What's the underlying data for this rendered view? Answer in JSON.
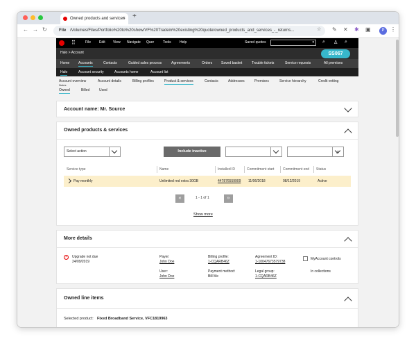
{
  "browser": {
    "tab_title": "Owned products and services",
    "tab_close": "×",
    "new_tab": "+",
    "url_scheme": "File",
    "url_path": "/Volumes/Files/Portfolio%20to%20show/VF%20Tradein%20existing%20quote/owned_products_and_services_-_returns...",
    "profile_initial": "P"
  },
  "top_menu": {
    "items": [
      "File",
      "Edit",
      "View",
      "Navigate",
      "Quer",
      "Tools",
      "Help"
    ],
    "saved_quotes": "Saved quotes"
  },
  "header": {
    "breadcrumb": "Halo  >  Account",
    "badge": "SS067"
  },
  "main_nav": {
    "items": [
      "Home",
      "Accounts",
      "Contacts",
      "Guided sales process",
      "Agreements",
      "Orders",
      "Saved basket",
      "Trouble tickets",
      "Service requests",
      "All premises"
    ],
    "active": "Accounts"
  },
  "sub_nav": {
    "items": [
      "Halo",
      "Account security",
      "Accounts home",
      "Account list"
    ],
    "active": "Halo"
  },
  "page_tabs": {
    "items": [
      "Account overview",
      "Account details",
      "Billing profiles",
      "Product & services",
      "Contacts",
      "Addresses",
      "Premises",
      "Service hierarchy",
      "Credit vetting"
    ],
    "notes": "Notes",
    "active": "Product & services"
  },
  "status_tabs": {
    "items": [
      "Owned",
      "Billed",
      "Used"
    ],
    "active": "Owned"
  },
  "account_panel": {
    "title": "Account name: Mr. Source"
  },
  "products_panel": {
    "title": "Owned products & services",
    "select_action": "Select action",
    "include_inactive": "Include inactive",
    "columns": [
      "Service type",
      "Name",
      "Installed ID",
      "Commitment start",
      "Commitment end",
      "Status"
    ],
    "rows": [
      {
        "service_type": "Pay monthly",
        "name": "Unlimited red extra 30GB",
        "installed_id": "447876559909",
        "commitment_start": "11/06/2018",
        "commitment_end": "08/12/2019",
        "status": "Active"
      }
    ],
    "pagination": "1 - 1 of 1",
    "prev": "«",
    "next": "»",
    "show_more": "Show more"
  },
  "details_panel": {
    "title": "More details",
    "upgrade_label": "Upgrade not due",
    "upgrade_date": "24/09/2019",
    "payer_label": "Payer:",
    "payer": "John Doe",
    "user_label": "User:",
    "user": "John Doe",
    "billing_label": "Billing profile:",
    "billing": "1-CQARB46Z",
    "payment_label": "Payment method:",
    "payment": "Bill Me",
    "agreement_label": "Agreement ID:",
    "agreement": "1-10047673579738",
    "legal_label": "Legal group:",
    "legal": "1-CQARB46Z",
    "myaccount": "MyAccount controls",
    "collections": "In collections"
  },
  "line_items_panel": {
    "title": "Owned line items",
    "selected_label": "Selected product:",
    "selected_product": "Fixed Broadband Service, VFC1819963"
  },
  "colors": {
    "accent": "#37b7cb",
    "brand_red": "#e60000",
    "row_highlight": "#fcefcb",
    "button_grey": "#6a6a6a"
  }
}
